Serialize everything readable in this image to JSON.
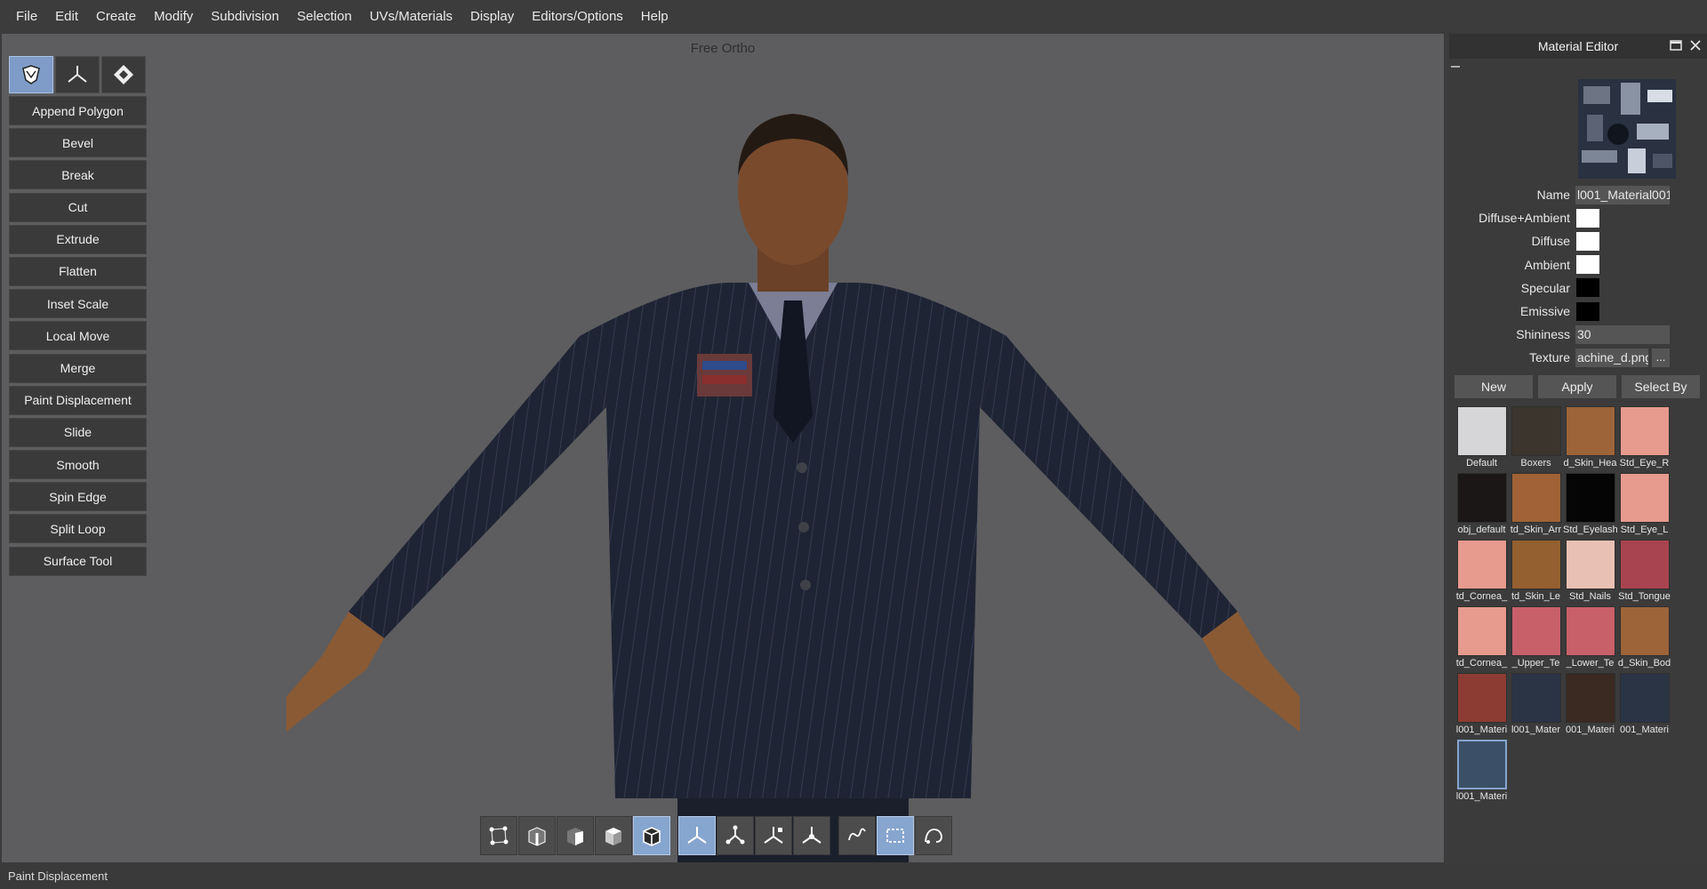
{
  "menu": [
    "File",
    "Edit",
    "Create",
    "Modify",
    "Subdivision",
    "Selection",
    "UVs/Materials",
    "Display",
    "Editors/Options",
    "Help"
  ],
  "viewport": {
    "title": "Free Ortho"
  },
  "tool_modes": [
    {
      "icon": "face-mode-icon",
      "active": true
    },
    {
      "icon": "transform-mode-icon",
      "active": false
    },
    {
      "icon": "uv-mode-icon",
      "active": false
    }
  ],
  "tools": [
    "Append Polygon",
    "Bevel",
    "Break",
    "Cut",
    "Extrude",
    "Flatten",
    "Inset Scale",
    "Local Move",
    "Merge",
    "Paint Displacement",
    "Slide",
    "Smooth",
    "Spin Edge",
    "Split Loop",
    "Surface Tool"
  ],
  "bottom_toolbar": [
    {
      "icon": "vertex-select-icon",
      "active": false
    },
    {
      "icon": "edge-select-icon",
      "active": false
    },
    {
      "icon": "face-select-icon",
      "active": false
    },
    {
      "icon": "object-select-icon",
      "active": false
    },
    {
      "icon": "solid-cube-icon",
      "active": true
    },
    {
      "icon": "move-gizmo-icon",
      "active": true
    },
    {
      "icon": "rotate-gizmo-icon",
      "active": false
    },
    {
      "icon": "scale-gizmo-icon",
      "active": false
    },
    {
      "icon": "universal-gizmo-icon",
      "active": false
    },
    {
      "icon": "lasso-select-icon",
      "active": false
    },
    {
      "icon": "rectangle-select-icon",
      "active": true
    },
    {
      "icon": "paint-select-icon",
      "active": false
    }
  ],
  "status": {
    "text": "Paint Displacement"
  },
  "material_editor": {
    "title": "Material Editor",
    "fields": {
      "name_label": "Name",
      "name_value": "l001_Material001",
      "diffuse_ambient_label": "Diffuse+Ambient",
      "diffuse_ambient_color": "#ffffff",
      "diffuse_label": "Diffuse",
      "diffuse_color": "#ffffff",
      "ambient_label": "Ambient",
      "ambient_color": "#ffffff",
      "specular_label": "Specular",
      "specular_color": "#000000",
      "emissive_label": "Emissive",
      "emissive_color": "#000000",
      "shininess_label": "Shininess",
      "shininess_value": "30",
      "texture_label": "Texture",
      "texture_value": "achine_d.png",
      "browse_label": "..."
    },
    "buttons": {
      "new": "New",
      "apply": "Apply",
      "select_by": "Select By"
    },
    "materials": [
      {
        "label": "Default",
        "color": "#d6d6d8"
      },
      {
        "label": "Boxers",
        "color": "#3b352e"
      },
      {
        "label": "d_Skin_Hea",
        "color": "#9c6438"
      },
      {
        "label": "Std_Eye_R",
        "color": "#e79a8e"
      },
      {
        "label": "obj_default",
        "color": "#1a1716"
      },
      {
        "label": "td_Skin_Arr",
        "color": "#a06236"
      },
      {
        "label": "Std_Eyelash",
        "color": "#050505"
      },
      {
        "label": "Std_Eye_L",
        "color": "#e79a8e"
      },
      {
        "label": "td_Cornea_",
        "color": "#e79a8e"
      },
      {
        "label": "td_Skin_Le",
        "color": "#95602f"
      },
      {
        "label": "Std_Nails",
        "color": "#e9c1b4"
      },
      {
        "label": "Std_Tongue",
        "color": "#a8444f"
      },
      {
        "label": "td_Cornea_",
        "color": "#e79a8e"
      },
      {
        "label": "_Upper_Te",
        "color": "#c8606a"
      },
      {
        "label": "_Lower_Te",
        "color": "#c8606a"
      },
      {
        "label": "d_Skin_Bod",
        "color": "#9c6438"
      },
      {
        "label": "l001_Materi",
        "color": "#8c3c33"
      },
      {
        "label": "l001_Mater",
        "color": "#2b3445"
      },
      {
        "label": "001_Materi",
        "color": "#3a2a22"
      },
      {
        "label": "001_Materi",
        "color": "#2b3445"
      },
      {
        "label": "l001_Materi",
        "color": "#3b4f66"
      }
    ]
  }
}
